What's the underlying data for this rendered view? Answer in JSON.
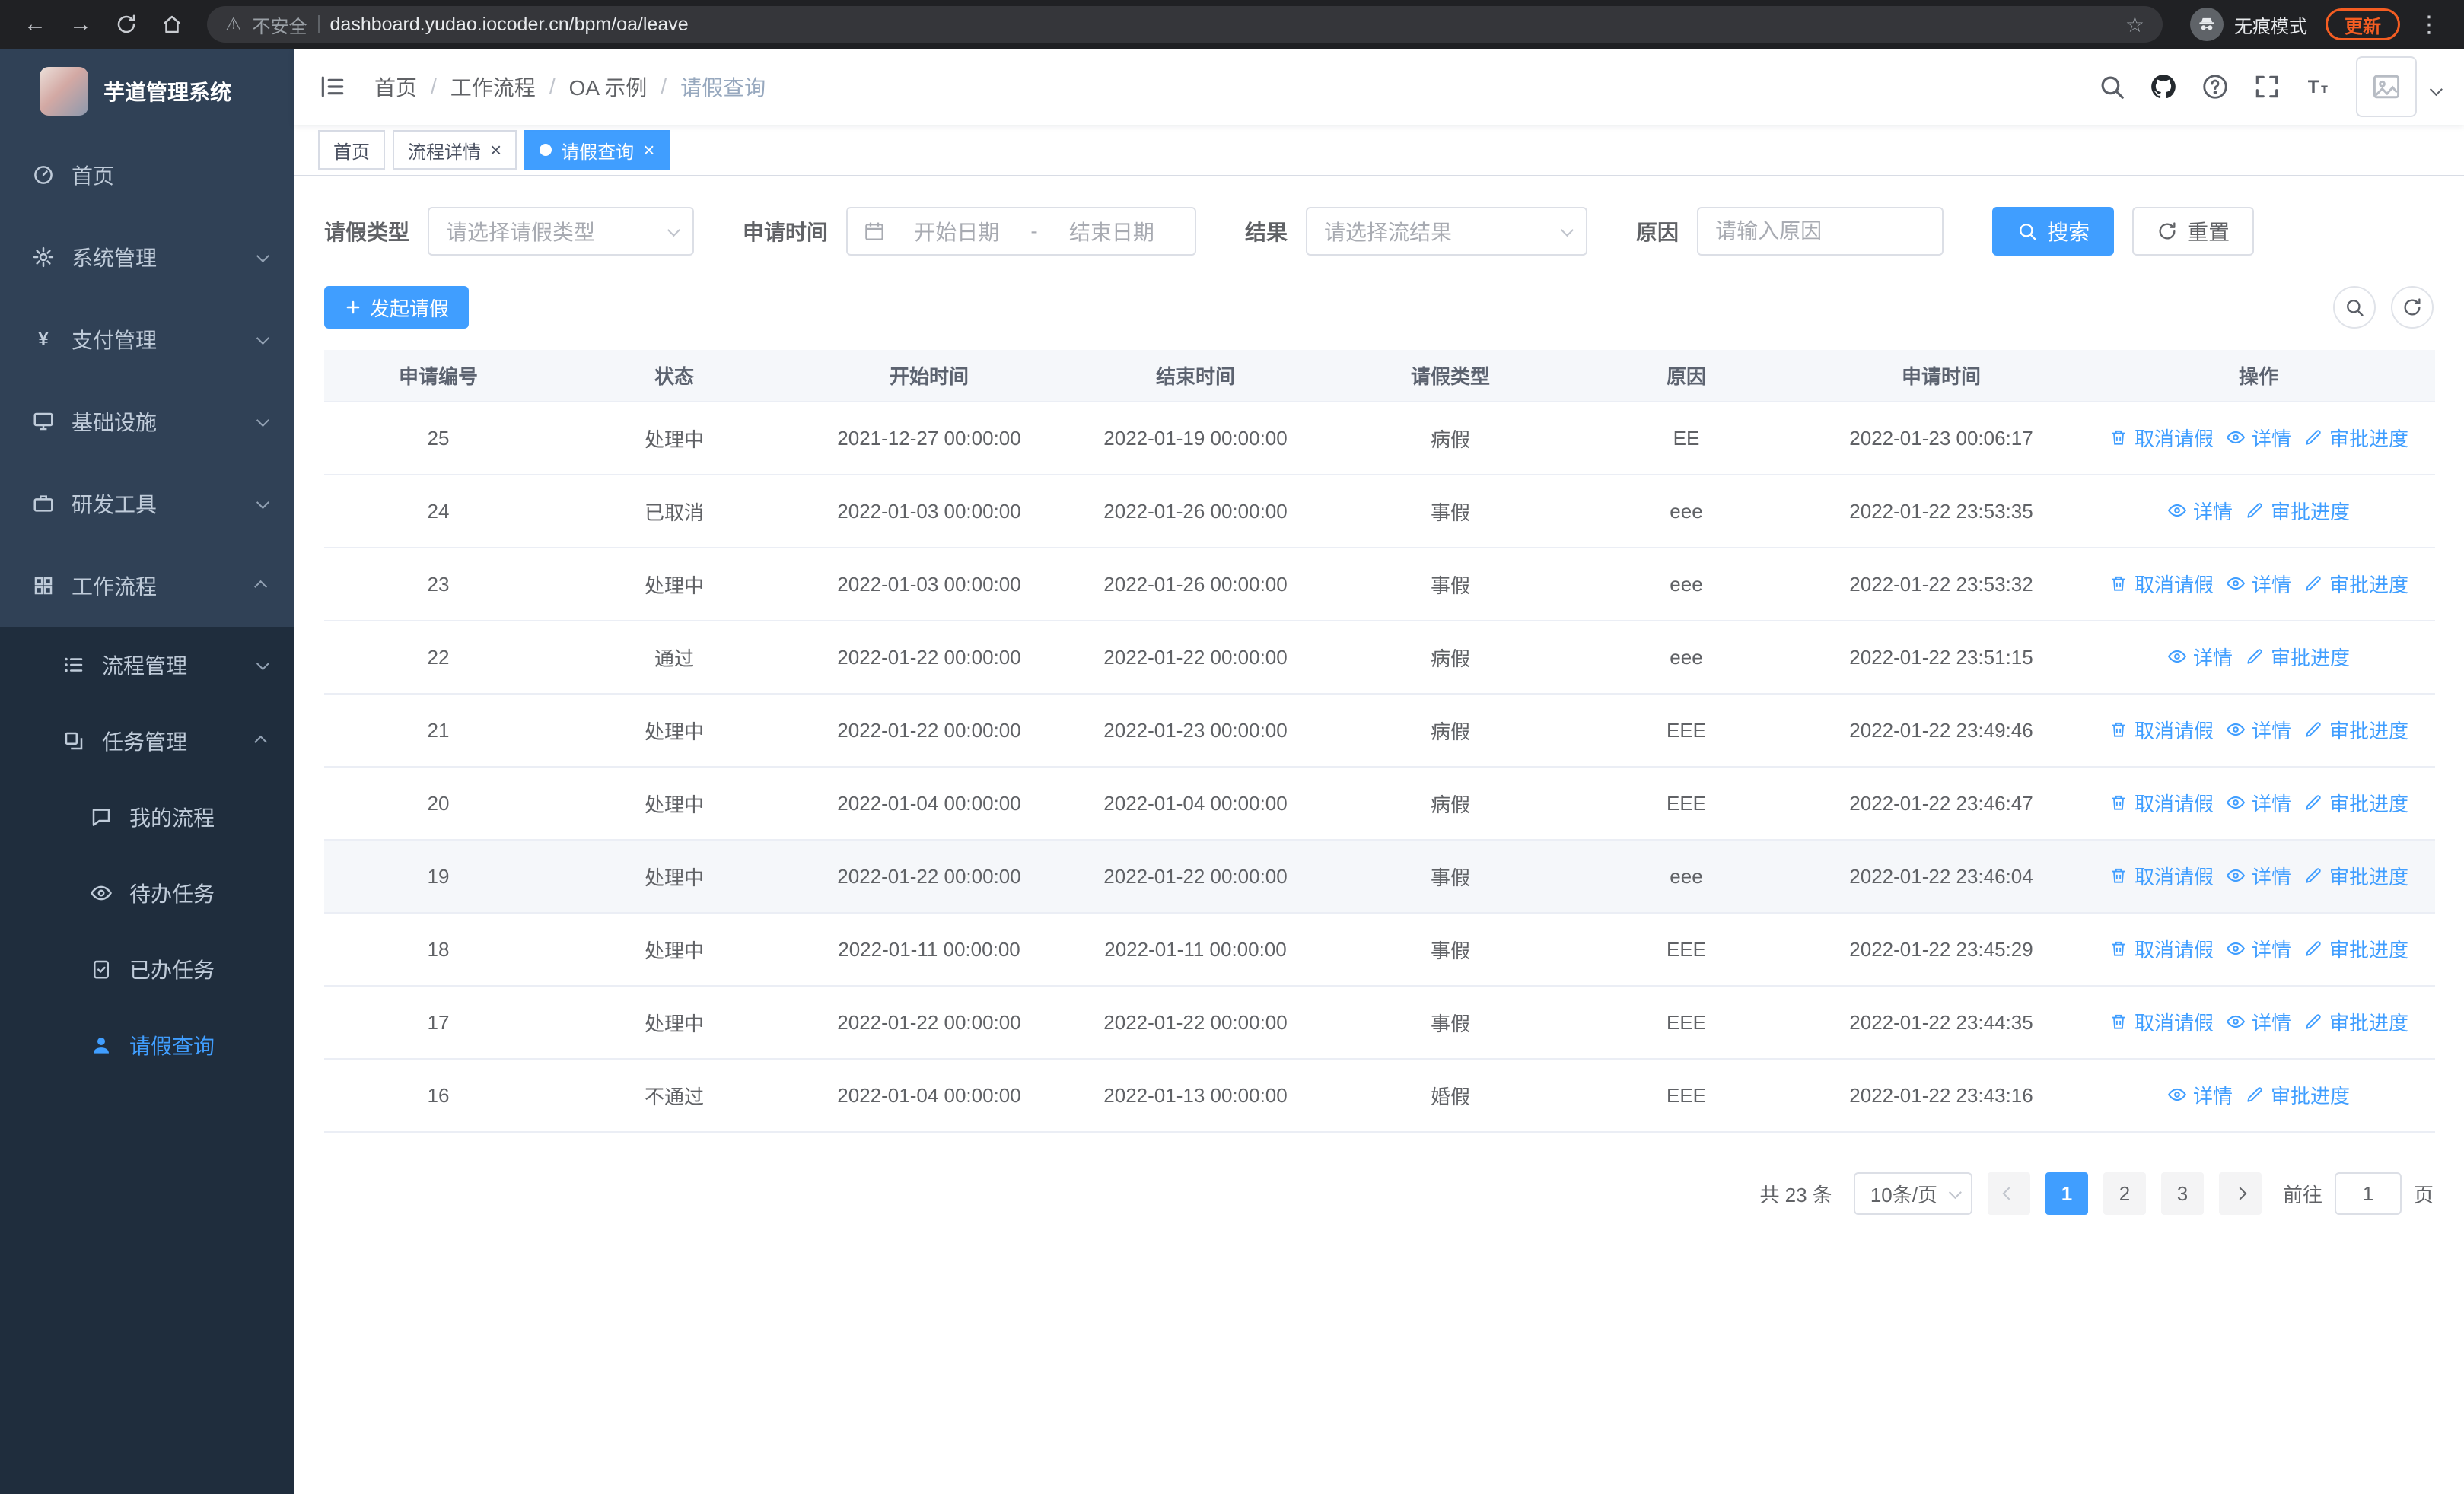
{
  "browser": {
    "security_label": "不安全",
    "url": "dashboard.yudao.iocoder.cn/bpm/oa/leave",
    "incognito_label": "无痕模式",
    "update_label": "更新"
  },
  "sidebar": {
    "logo_title": "芋道管理系统",
    "menu": [
      {
        "name": "home",
        "label": "首页",
        "icon": "dashboard-icon",
        "level": 1
      },
      {
        "name": "system-management",
        "label": "系统管理",
        "icon": "gear-icon",
        "level": 1,
        "arrow": "down"
      },
      {
        "name": "payment-management",
        "label": "支付管理",
        "icon": "yen-icon",
        "level": 1,
        "arrow": "down"
      },
      {
        "name": "infrastructure",
        "label": "基础设施",
        "icon": "monitor-icon",
        "level": 1,
        "arrow": "down"
      },
      {
        "name": "dev-tools",
        "label": "研发工具",
        "icon": "briefcase-icon",
        "level": 1,
        "arrow": "down"
      },
      {
        "name": "workflow",
        "label": "工作流程",
        "icon": "grid-icon",
        "level": 1,
        "arrow": "up",
        "open": true
      },
      {
        "name": "process-management",
        "label": "流程管理",
        "icon": "list-icon",
        "level": 2,
        "arrow": "down",
        "dark": true
      },
      {
        "name": "task-management",
        "label": "任务管理",
        "icon": "layers-icon",
        "level": 2,
        "arrow": "up",
        "dark": true
      },
      {
        "name": "my-process",
        "label": "我的流程",
        "icon": "chat-icon",
        "level": 3,
        "dark": true
      },
      {
        "name": "todo-tasks",
        "label": "待办任务",
        "icon": "eye-icon",
        "level": 3,
        "dark": true
      },
      {
        "name": "done-tasks",
        "label": "已办任务",
        "icon": "clipboard-check-icon",
        "level": 3,
        "dark": true
      },
      {
        "name": "leave-query",
        "label": "请假查询",
        "icon": "user-icon",
        "level": 3,
        "dark": true,
        "active": true
      }
    ]
  },
  "header": {
    "breadcrumb": [
      "首页",
      "工作流程",
      "OA 示例",
      "请假查询"
    ]
  },
  "tabs": [
    {
      "name": "home",
      "label": "首页"
    },
    {
      "name": "process-detail",
      "label": "流程详情",
      "closable": true
    },
    {
      "name": "leave-query",
      "label": "请假查询",
      "closable": true,
      "active": true
    }
  ],
  "filters": {
    "leave_type_label": "请假类型",
    "leave_type_placeholder": "请选择请假类型",
    "apply_time_label": "申请时间",
    "start_date_placeholder": "开始日期",
    "range_separator": "-",
    "end_date_placeholder": "结束日期",
    "result_label": "结果",
    "result_placeholder": "请选择流结果",
    "reason_label": "原因",
    "reason_placeholder": "请输入原因",
    "search_label": "搜索",
    "reset_label": "重置"
  },
  "toolbar": {
    "create_label": "发起请假"
  },
  "table": {
    "columns": [
      "申请编号",
      "状态",
      "开始时间",
      "结束时间",
      "请假类型",
      "原因",
      "申请时间",
      "操作"
    ],
    "action_labels": {
      "cancel": "取消请假",
      "detail": "详情",
      "progress": "审批进度"
    },
    "action_icons": {
      "cancel": "delete-icon",
      "detail": "eye-icon",
      "progress": "edit-icon"
    },
    "rows": [
      {
        "id": "25",
        "status": "处理中",
        "start": "2021-12-27 00:00:00",
        "end": "2022-01-19 00:00:00",
        "type": "病假",
        "reason": "EE",
        "apply_time": "2022-01-23 00:06:17",
        "actions": [
          "cancel",
          "detail",
          "progress"
        ]
      },
      {
        "id": "24",
        "status": "已取消",
        "start": "2022-01-03 00:00:00",
        "end": "2022-01-26 00:00:00",
        "type": "事假",
        "reason": "eee",
        "apply_time": "2022-01-22 23:53:35",
        "actions": [
          "detail",
          "progress"
        ]
      },
      {
        "id": "23",
        "status": "处理中",
        "start": "2022-01-03 00:00:00",
        "end": "2022-01-26 00:00:00",
        "type": "事假",
        "reason": "eee",
        "apply_time": "2022-01-22 23:53:32",
        "actions": [
          "cancel",
          "detail",
          "progress"
        ]
      },
      {
        "id": "22",
        "status": "通过",
        "start": "2022-01-22 00:00:00",
        "end": "2022-01-22 00:00:00",
        "type": "病假",
        "reason": "eee",
        "apply_time": "2022-01-22 23:51:15",
        "actions": [
          "detail",
          "progress"
        ]
      },
      {
        "id": "21",
        "status": "处理中",
        "start": "2022-01-22 00:00:00",
        "end": "2022-01-23 00:00:00",
        "type": "病假",
        "reason": "EEE",
        "apply_time": "2022-01-22 23:49:46",
        "actions": [
          "cancel",
          "detail",
          "progress"
        ]
      },
      {
        "id": "20",
        "status": "处理中",
        "start": "2022-01-04 00:00:00",
        "end": "2022-01-04 00:00:00",
        "type": "病假",
        "reason": "EEE",
        "apply_time": "2022-01-22 23:46:47",
        "actions": [
          "cancel",
          "detail",
          "progress"
        ]
      },
      {
        "id": "19",
        "status": "处理中",
        "start": "2022-01-22 00:00:00",
        "end": "2022-01-22 00:00:00",
        "type": "事假",
        "reason": "eee",
        "apply_time": "2022-01-22 23:46:04",
        "actions": [
          "cancel",
          "detail",
          "progress"
        ],
        "highlight": true
      },
      {
        "id": "18",
        "status": "处理中",
        "start": "2022-01-11 00:00:00",
        "end": "2022-01-11 00:00:00",
        "type": "事假",
        "reason": "EEE",
        "apply_time": "2022-01-22 23:45:29",
        "actions": [
          "cancel",
          "detail",
          "progress"
        ]
      },
      {
        "id": "17",
        "status": "处理中",
        "start": "2022-01-22 00:00:00",
        "end": "2022-01-22 00:00:00",
        "type": "事假",
        "reason": "EEE",
        "apply_time": "2022-01-22 23:44:35",
        "actions": [
          "cancel",
          "detail",
          "progress"
        ]
      },
      {
        "id": "16",
        "status": "不通过",
        "start": "2022-01-04 00:00:00",
        "end": "2022-01-13 00:00:00",
        "type": "婚假",
        "reason": "EEE",
        "apply_time": "2022-01-22 23:43:16",
        "actions": [
          "detail",
          "progress"
        ]
      }
    ]
  },
  "pagination": {
    "total_label": "共 23 条",
    "page_size_label": "10条/页",
    "pages": [
      "1",
      "2",
      "3"
    ],
    "active_page": "1",
    "goto_label": "前往",
    "goto_value": "1",
    "goto_unit_label": "页"
  },
  "colors": {
    "primary": "#409eff",
    "link": "#409eff",
    "sidebar_bg": "#304156",
    "sidebar_submenu_bg": "#1f2d3d",
    "sidebar_text": "#bfcbd9",
    "table_header_bg": "#f5f7fa",
    "row_hover_bg": "#f5f7fa",
    "update_chip": "#f45d22",
    "chrome_bg": "#202124",
    "omnibox_bg": "#35363a"
  }
}
